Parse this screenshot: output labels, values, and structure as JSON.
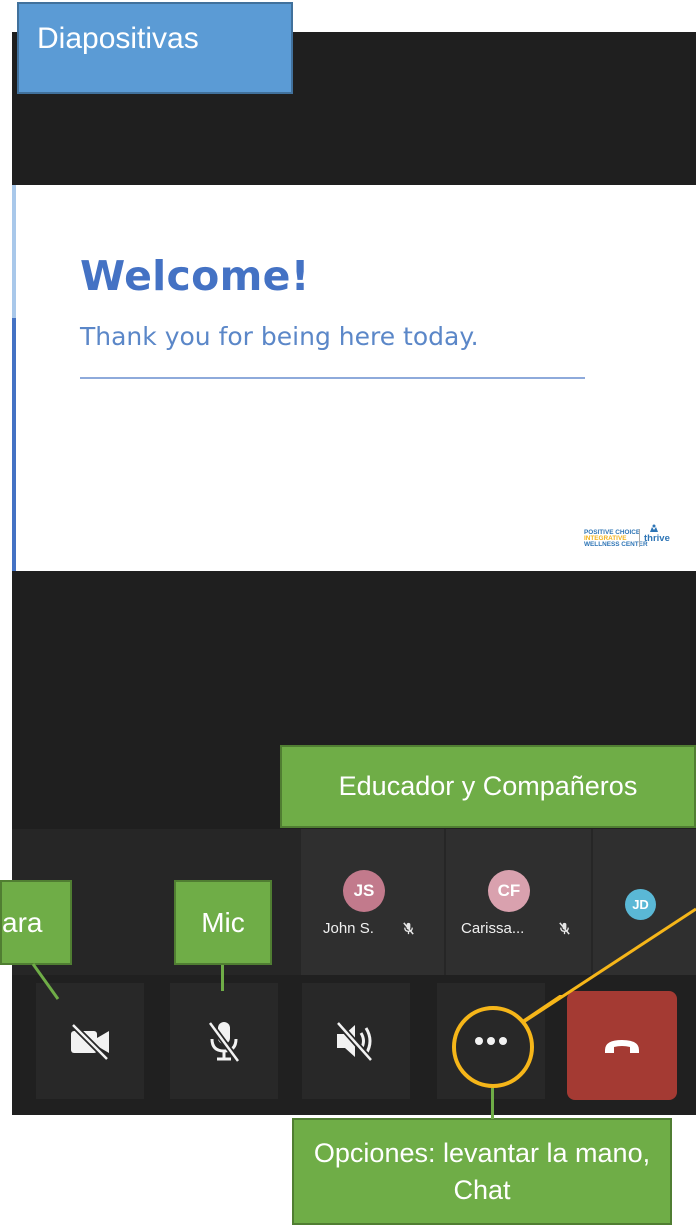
{
  "callouts": {
    "slides": "Diapositivas",
    "participants": "Educador y Compañeros",
    "camera": "ara",
    "mic": "Mic",
    "options": "Opciones: levantar la mano, Chat"
  },
  "slide": {
    "title": "Welcome!",
    "subtitle": "Thank you for being here today.",
    "logo": {
      "line1": "POSITIVE CHOICE",
      "line2": "INTEGRATIVE",
      "line3": "WELLNESS CENTER",
      "brand": "thrive"
    }
  },
  "participants": [
    {
      "initials": "JS",
      "name": "John S.",
      "color": "#c27a8c",
      "muted": true
    },
    {
      "initials": "CF",
      "name": "Carissa...",
      "color": "#d9a1ae",
      "muted": true
    },
    {
      "initials": "JD",
      "name": "",
      "color": "#5ab8d6",
      "muted": false
    }
  ],
  "toolbar": {
    "camera": "camera-off-icon",
    "mic": "mic-off-icon",
    "speaker": "speaker-off-icon",
    "more": "more-options-icon",
    "hangup": "hang-up-icon"
  },
  "colors": {
    "callout_green": "#6fad47",
    "callout_blue": "#5b9bd5",
    "highlight_ring": "#f6b619",
    "hangup_red": "#a43a33",
    "slide_title": "#4472c4"
  }
}
